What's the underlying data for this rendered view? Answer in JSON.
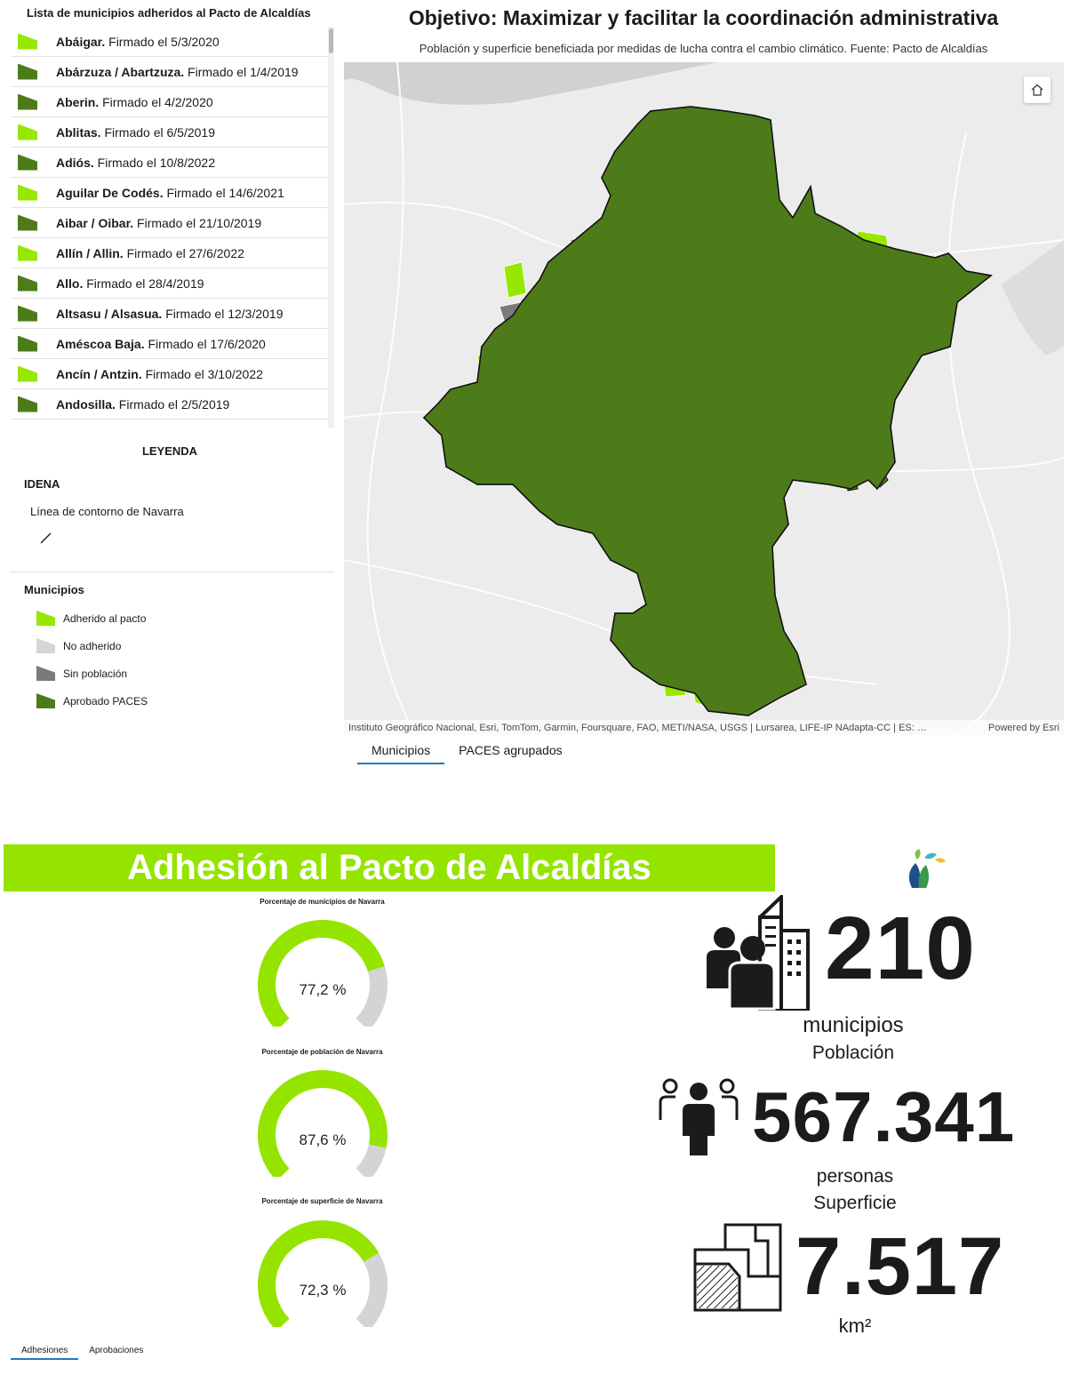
{
  "list": {
    "title": "Lista de municipios adheridos al Pacto de Alcaldías",
    "items": [
      {
        "name": "Abáigar.",
        "text": " Firmado el 5/3/2020",
        "status": "adherido"
      },
      {
        "name": "Abárzuza / Abartzuza.",
        "text": " Firmado el 1/4/2019",
        "status": "paces"
      },
      {
        "name": "Aberin.",
        "text": " Firmado el 4/2/2020",
        "status": "paces"
      },
      {
        "name": "Ablitas.",
        "text": " Firmado el 6/5/2019",
        "status": "adherido"
      },
      {
        "name": "Adiós.",
        "text": " Firmado el 10/8/2022",
        "status": "paces"
      },
      {
        "name": "Aguilar De Codés.",
        "text": " Firmado el 14/6/2021",
        "status": "adherido"
      },
      {
        "name": "Aibar / Oibar.",
        "text": " Firmado el 21/10/2019",
        "status": "paces"
      },
      {
        "name": "Allín / Allin.",
        "text": " Firmado el 27/6/2022",
        "status": "adherido"
      },
      {
        "name": "Allo.",
        "text": " Firmado el 28/4/2019",
        "status": "paces"
      },
      {
        "name": "Altsasu / Alsasua.",
        "text": " Firmado el 12/3/2019",
        "status": "paces"
      },
      {
        "name": "Améscoa Baja.",
        "text": " Firmado el 17/6/2020",
        "status": "paces"
      },
      {
        "name": "Ancín / Antzin.",
        "text": " Firmado el 3/10/2022",
        "status": "adherido"
      },
      {
        "name": "Andosilla.",
        "text": " Firmado el 2/5/2019",
        "status": "paces"
      }
    ]
  },
  "legend": {
    "title": "LEYENDA",
    "group1": "IDENA",
    "line_label": "Línea de contorno de Navarra",
    "group2": "Municipios",
    "items": [
      {
        "label": "Adherido al pacto",
        "status": "adherido"
      },
      {
        "label": "No adherido",
        "status": "no_adherido"
      },
      {
        "label": "Sin población",
        "status": "sin_poblacion"
      },
      {
        "label": "Aprobado PACES",
        "status": "paces"
      }
    ]
  },
  "colors": {
    "adherido": "#96e800",
    "no_adherido": "#d3d6d8",
    "sin_poblacion": "#7a7a7a",
    "paces": "#4d7b1a",
    "banner": "#95e400",
    "gauge_fill": "#95e400",
    "gauge_track": "#d4d4d4",
    "tab_underline": "#1f7bbf"
  },
  "map": {
    "title": "Objetivo: Maximizar y facilitar la coordinación administrativa",
    "subtitle": "Población y superficie beneficiada por medidas de lucha contra el cambio climático. Fuente: Pacto de Alcaldías",
    "attribution": "Instituto Geográfico Nacional, Esri, TomTom, Garmin, Foursquare, FAO, METI/NASA, USGS | Lursarea, LIFE-IP NAdapta-CC | ES: …",
    "powered_by": "Powered by Esri",
    "home_icon": "home-icon",
    "tabs": [
      {
        "label": "Municipios",
        "active": true
      },
      {
        "label": "PACES agrupados",
        "active": false
      }
    ]
  },
  "dashboard": {
    "banner_title": "Adhesión al Pacto de Alcaldías",
    "gauges": [
      {
        "label": "Porcentaje de municipios de Navarra",
        "value": 77.2,
        "display": "77,2 %"
      },
      {
        "label": "Porcentaje de población de Navarra",
        "value": 87.6,
        "display": "87,6 %"
      },
      {
        "label": "Porcentaje de superficie de Navarra",
        "value": 72.3,
        "display": "72,3 %"
      }
    ],
    "stats": {
      "municipios_value": "210",
      "municipios_caption": "municipios",
      "poblacion_title": "Población",
      "poblacion_value": "567.341",
      "poblacion_caption": "personas",
      "superficie_title": "Superficie",
      "superficie_value": "7.517",
      "superficie_caption": "km²"
    },
    "tabs": [
      {
        "label": "Adhesiones",
        "active": true
      },
      {
        "label": "Aprobaciones",
        "active": false
      }
    ]
  }
}
